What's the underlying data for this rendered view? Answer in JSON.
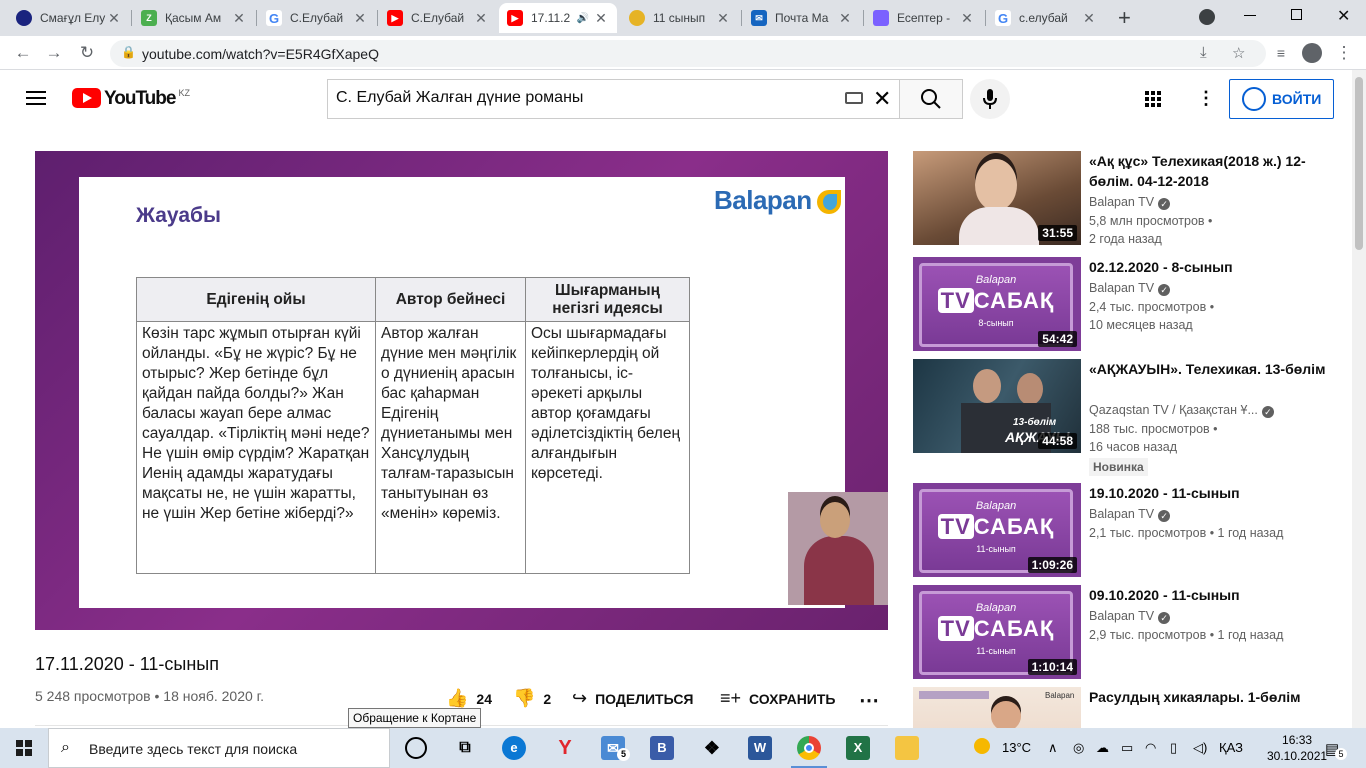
{
  "browser": {
    "tabs": [
      {
        "title": "Смағұл Елу",
        "color": "#1a237e",
        "active": false
      },
      {
        "title": "Қасым Ам",
        "color": "#4caf50",
        "active": false
      },
      {
        "title": "С.Елубай",
        "color": "#4285f4",
        "active": false
      },
      {
        "title": "С.Елубай",
        "color": "#ff0000",
        "active": false
      },
      {
        "title": "17.11.2",
        "color": "#ff0000",
        "active": true
      },
      {
        "title": "11 сынып",
        "color": "#e6b325",
        "active": false
      },
      {
        "title": "Почта Ма",
        "color": "#1565c0",
        "active": false
      },
      {
        "title": "Есептер - ",
        "color": "#7b61ff",
        "active": false
      },
      {
        "title": "с.елубай",
        "color": "#4285f4",
        "active": false
      }
    ],
    "new_tab": "+",
    "url": "youtube.com/watch?v=E5R4GfXapeQ"
  },
  "youtube": {
    "logo_text": "YouTube",
    "country": "KZ",
    "search_value": "С. Елубай Жалған дүние романы",
    "signin_label": "ВОЙТИ"
  },
  "slide": {
    "brand": "Balapan",
    "heading": "Жауабы",
    "columns": [
      "Едігенің ойы",
      "Автор бейнесі",
      "Шығарманың негізгі идеясы"
    ],
    "cells": [
      "Көзін тарс жұмып отырған күйі ойланды. «Бұ не жүріс? Бұ не отырыс? Жер бетінде бұл қайдан пайда болды?» Жан баласы жауап бере алмас сауалдар. «Тірліктің мәні неде? Не үшін өмір сүрдім? Жаратқан Иенің адамды жаратудағы мақсаты не, не үшін жаратты, не үшін Жер бетіне жіберді?»",
      "Автор жалған дүние мен мәңгілік о дүниенің арасын бас қаһарман Едігенің дүниетанымы мен Хансұлудың талғам-таразысын танытуынан өз «менін» көреміз.",
      "Осы шығармадағы кейіпкерлердің ой толғанысы, іс-әрекеті арқылы автор қоғамдағы әділетсіздіктің белең алғандығын көрсетеді."
    ]
  },
  "video": {
    "title": "17.11.2020 - 11-сынып",
    "stats": "5 248 просмотров • 18 нояб. 2020 г.",
    "likes": "24",
    "dislikes": "2",
    "share": "ПОДЕЛИТЬСЯ",
    "save": "СОХРАНИТЬ",
    "tooltip": "Обращение к Кортане"
  },
  "related": [
    {
      "title": "«Ақ құс» Телехикая(2018 ж.) 12-бөлім. 04-12-2018",
      "channel": "Balapan TV",
      "views": "5,8 млн просмотров •",
      "age": "2 года назад",
      "duration": "31:55",
      "badge": ""
    },
    {
      "title": "02.12.2020 - 8-сынып",
      "channel": "Balapan TV",
      "views": "2,4 тыс. просмотров •",
      "age": "10 месяцев назад",
      "duration": "54:42",
      "badge": "",
      "thumb_brand": "Balapan",
      "thumb_tv": "TV",
      "thumb_word": "САБАҚ",
      "thumb_grade": "8-сынып"
    },
    {
      "title": "«АҚЖАУЫН». Телехикая. 13-бөлім",
      "channel": "Qazaqstan TV / Қазақстан Ұ...",
      "views": "188 тыс. просмотров •",
      "age": "16 часов назад",
      "duration": "44:58",
      "badge": "Новинка",
      "thumb_caption": "13-бөлім",
      "thumb_show": "АҚЖАУЫ"
    },
    {
      "title": "19.10.2020 - 11-сынып",
      "channel": "Balapan TV",
      "views": "2,1 тыс. просмотров • 1 год назад",
      "age": "",
      "duration": "1:09:26",
      "badge": "",
      "thumb_brand": "Balapan",
      "thumb_tv": "TV",
      "thumb_word": "САБАҚ",
      "thumb_grade": "11-сынып"
    },
    {
      "title": "09.10.2020 - 11-сынып",
      "channel": "Balapan TV",
      "views": "2,9 тыс. просмотров • 1 год назад",
      "age": "",
      "duration": "1:10:14",
      "badge": "",
      "thumb_brand": "Balapan",
      "thumb_tv": "TV",
      "thumb_word": "САБАҚ",
      "thumb_grade": "11-сынып"
    },
    {
      "title": "Расулдың хикаялары. 1-бөлім",
      "channel": "",
      "views": "",
      "age": "",
      "duration": "",
      "badge": "",
      "thumb_brand": "Balapan"
    }
  ],
  "taskbar": {
    "search_placeholder": "Введите здесь текст для поиска",
    "mail_badge": "5",
    "weather": "13°C",
    "lang": "ҚАЗ",
    "time": "16:33",
    "date": "30.10.2021",
    "notif_count": "5"
  }
}
